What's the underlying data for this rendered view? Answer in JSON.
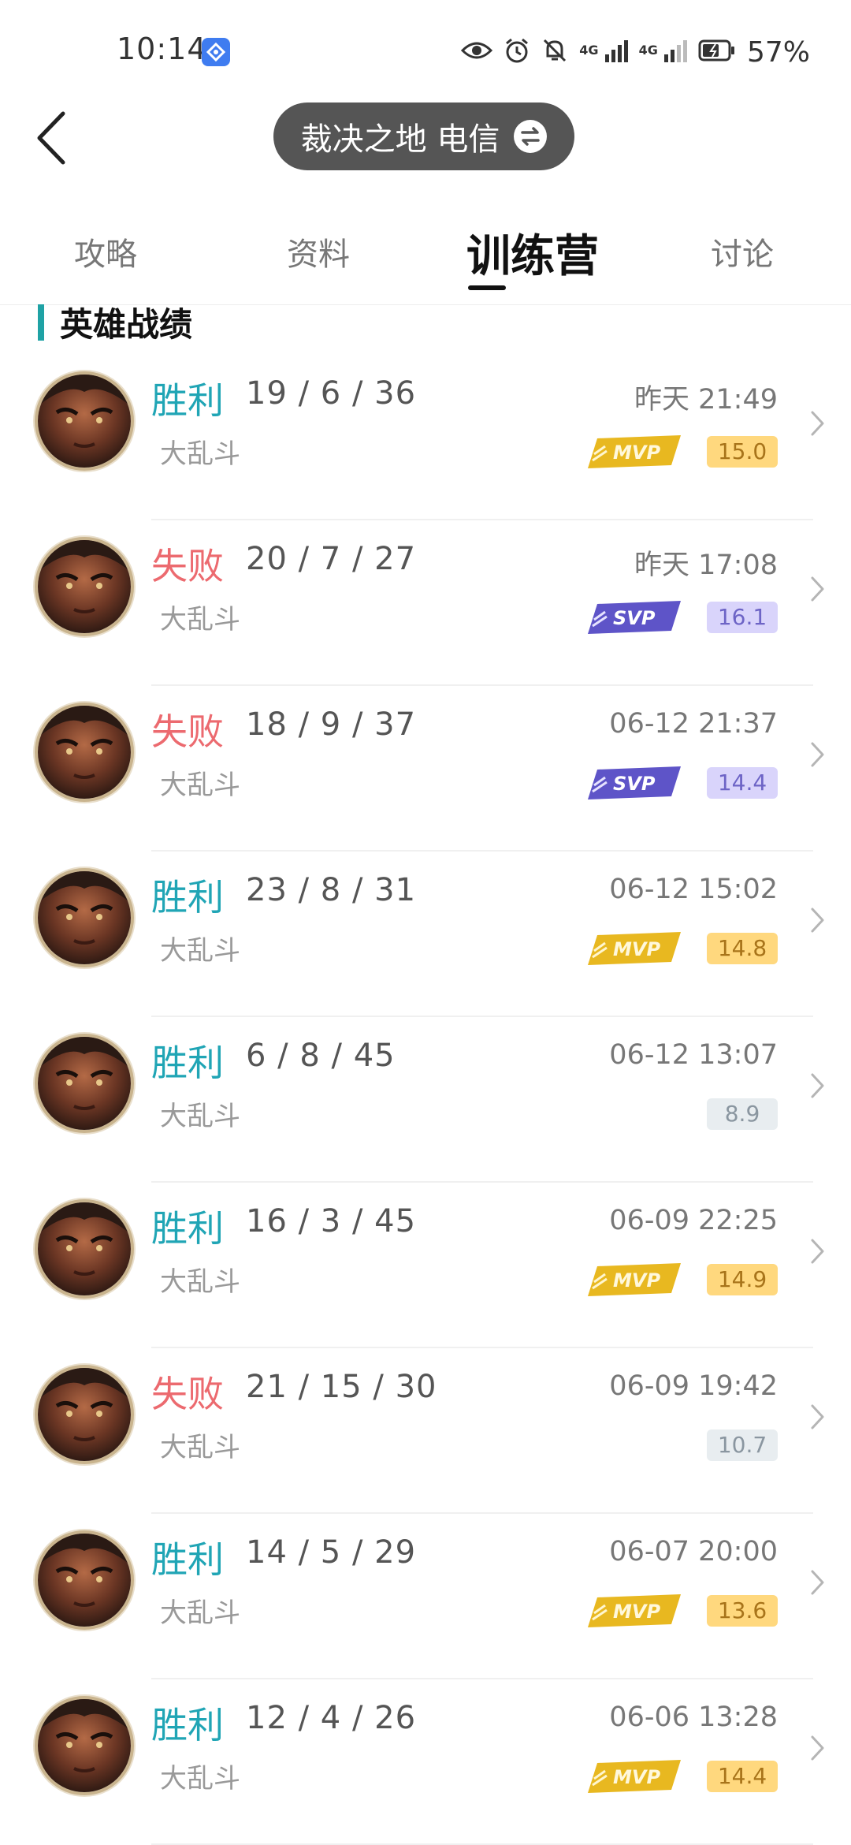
{
  "status_bar": {
    "time": "10:14",
    "battery": "57%",
    "signal_1": "4G",
    "signal_2": "4G",
    "icons": [
      "eye-icon",
      "alarm-icon",
      "mute-icon",
      "signal-4g-icon",
      "signal-4g-icon",
      "battery-icon"
    ]
  },
  "header": {
    "server_name": "裁决之地 电信",
    "back_icon": "back-icon",
    "swap_icon": "swap-icon"
  },
  "tabs": [
    {
      "label": "攻略",
      "active": false
    },
    {
      "label": "资料",
      "active": false
    },
    {
      "label": "训练营",
      "active": true
    },
    {
      "label": "讨论",
      "active": false
    }
  ],
  "section": {
    "title": "英雄战绩"
  },
  "matches": [
    {
      "result": "胜利",
      "kda": "19 / 6 / 36",
      "mode": "大乱斗",
      "time": "昨天 21:49",
      "badge": "mvp",
      "score": "15.0"
    },
    {
      "result": "失败",
      "kda": "20 / 7 / 27",
      "mode": "大乱斗",
      "time": "昨天 17:08",
      "badge": "svp",
      "score": "16.1"
    },
    {
      "result": "失败",
      "kda": "18 / 9 / 37",
      "mode": "大乱斗",
      "time": "06-12 21:37",
      "badge": "svp",
      "score": "14.4"
    },
    {
      "result": "胜利",
      "kda": "23 / 8 / 31",
      "mode": "大乱斗",
      "time": "06-12 15:02",
      "badge": "mvp",
      "score": "14.8"
    },
    {
      "result": "胜利",
      "kda": "6 / 8 / 45",
      "mode": "大乱斗",
      "time": "06-12 13:07",
      "badge": "none",
      "score": "8.9"
    },
    {
      "result": "胜利",
      "kda": "16 / 3 / 45",
      "mode": "大乱斗",
      "time": "06-09 22:25",
      "badge": "mvp",
      "score": "14.9"
    },
    {
      "result": "失败",
      "kda": "21 / 15 / 30",
      "mode": "大乱斗",
      "time": "06-09 19:42",
      "badge": "none",
      "score": "10.7"
    },
    {
      "result": "胜利",
      "kda": "14 / 5 / 29",
      "mode": "大乱斗",
      "time": "06-07 20:00",
      "badge": "mvp",
      "score": "13.6"
    },
    {
      "result": "胜利",
      "kda": "12 / 4 / 26",
      "mode": "大乱斗",
      "time": "06-06 13:28",
      "badge": "mvp",
      "score": "14.4"
    }
  ],
  "colors": {
    "win": "#20a5b5",
    "loss": "#ec6a6f",
    "accent": "#1fa2a5",
    "mvp": "#e8b820",
    "svp": "#5e54c8"
  }
}
